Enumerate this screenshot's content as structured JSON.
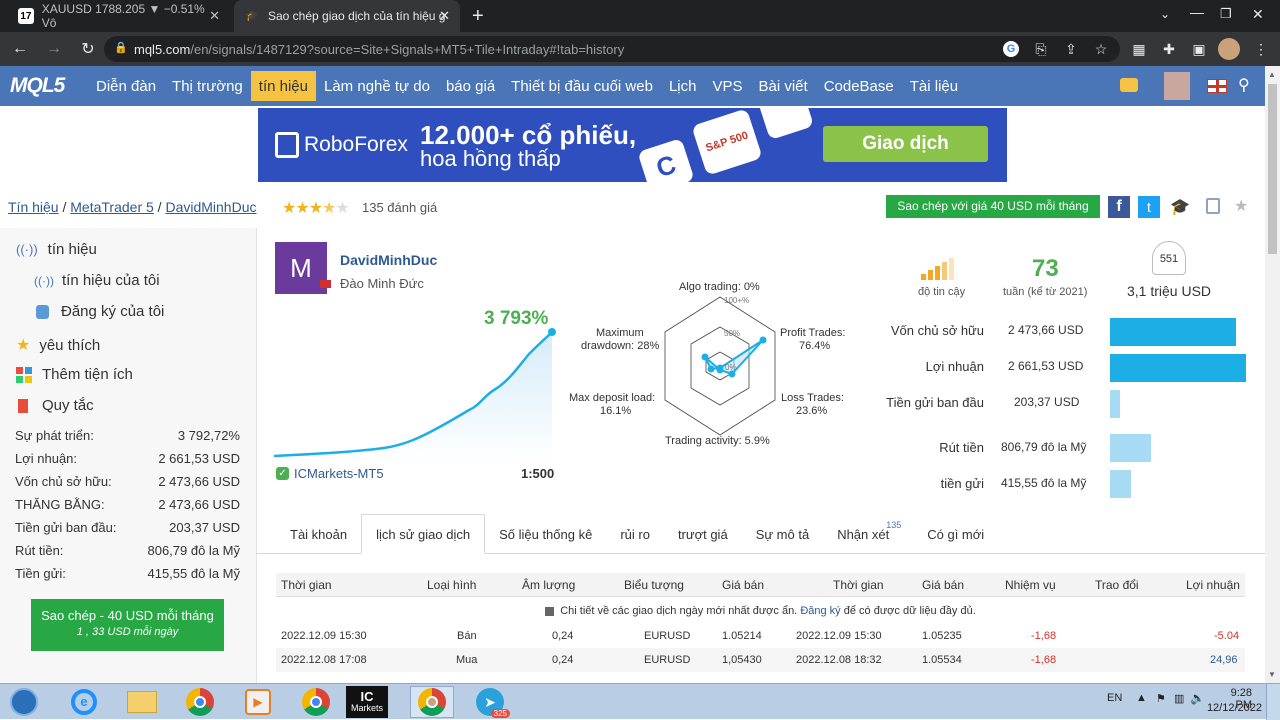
{
  "browser": {
    "tabs": [
      {
        "title": "XAUUSD 1788.205 ▼ −0.51% Vô",
        "icon": "tradingview-icon"
      },
      {
        "title": "Sao chép giao dịch của tín hiệu g",
        "icon": "mql5-icon"
      }
    ],
    "new_tab": "+",
    "url_host": "mql5.com",
    "url_path": "/en/signals/1487129?source=Site+Signals+MT5+Tile+Intraday#!tab=history"
  },
  "nav": {
    "logo": "MQL5",
    "items": [
      "Diễn đàn",
      "Thị trường",
      "tín hiệu",
      "Làm nghề tự do",
      "báo giá",
      "Thiết bị đầu cuối web",
      "Lịch",
      "VPS",
      "Bài viết",
      "CodeBase",
      "Tài liệu"
    ],
    "active": 2
  },
  "banner": {
    "brand": "RoboForex",
    "headline": "12.000+ cổ phiếu,",
    "subline": "hoa hồng thấp",
    "cta": "Giao dịch",
    "chip": "S&P 500"
  },
  "crumbs": {
    "items": [
      "Tín hiệu",
      "MetaTrader 5",
      "DavidMinhDuc"
    ],
    "sep": "/",
    "rating_count": "135 đánh giá",
    "copy_button": "Sao chép với giá 40 USD mỗi tháng"
  },
  "sidebar": {
    "links": [
      "tín hiệu",
      "tín hiệu của tôi",
      "Đăng ký của tôi",
      "yêu thích",
      "Thêm tiện ích",
      "Quy tắc"
    ],
    "stats": [
      {
        "label": "Sự phát triển:",
        "value": "3 792,72%"
      },
      {
        "label": "Lợi nhuận:",
        "value": "2 661,53 USD"
      },
      {
        "label": "Vốn chủ sở hữu:",
        "value": "2 473,66 USD"
      },
      {
        "label": "THĂNG BẰNG:",
        "value": "2 473,66 USD"
      },
      {
        "label": "Tiền gửi ban đầu:",
        "value": "203,37 USD"
      },
      {
        "label": "Rút tiền:",
        "value": "806,79 đô la Mỹ"
      },
      {
        "label": "Tiền gửi:",
        "value": "415,55 đô la Mỹ"
      }
    ],
    "copy_button": "Sao chép - 40 USD mỗi tháng",
    "copy_sub": "1 , 33 USD mỗi ngày"
  },
  "signal": {
    "avatar_letter": "M",
    "name": "DavidMinhDuc",
    "real_name": "Đào Minh Đức",
    "growth": "3 793%",
    "broker": "ICMarkets-MT5",
    "leverage": "1:500"
  },
  "radar": {
    "labels": {
      "algo": "Algo trading: 0%",
      "profit": "Profit Trades:",
      "profit_val": "76.4%",
      "loss": "Loss Trades:",
      "loss_val": "23.6%",
      "activity": "Trading activity: 5.9%",
      "deposit": "Max deposit load:",
      "deposit_val": "16.1%",
      "drawdown": "Maximum",
      "drawdown2": "drawdown: 28%"
    },
    "ticks": [
      "100+%",
      "50%",
      "0%"
    ]
  },
  "metrics": {
    "reliability_label": "độ tin cậy",
    "weeks": "73",
    "weeks_label": "tuần (kể từ 2021)",
    "subscribers": "551",
    "funds": "3,1 triệu USD"
  },
  "bars": [
    {
      "label": "Vốn chủ sở hữu",
      "value": "2 473,66 USD",
      "fraction": 0.93,
      "color": "#1eaee6"
    },
    {
      "label": "Lợi nhuận",
      "value": "2 661,53 USD",
      "fraction": 1.0,
      "color": "#1eaee6"
    },
    {
      "label": "Tiền gửi ban đầu",
      "value": "203,37 USD",
      "fraction": 0.076,
      "color": "#a6dbf3"
    },
    {
      "label": "Rút tiền",
      "value": "806,79 đô la Mỹ",
      "fraction": 0.3,
      "color": "#a6dbf3"
    },
    {
      "label": "tiền gửi",
      "value": "415,55 đô la Mỹ",
      "fraction": 0.156,
      "color": "#a6dbf3"
    }
  ],
  "tabs": {
    "items": [
      "Tài khoản",
      "lịch sử giao dịch",
      "Số liệu thống kê",
      "rủi ro",
      "trượt giá",
      "Sự mô tả",
      "Nhận xét",
      "Có gì mới"
    ],
    "active": 1,
    "review_badge": "135"
  },
  "history": {
    "headers": [
      "Thời gian",
      "Loại hình",
      "Âm lượng",
      "Biểu tượng",
      "Giá bán",
      "Thời gian",
      "Giá bán",
      "Nhiệm vụ",
      "Trao đổi",
      "Lợi nhuận"
    ],
    "notice_pre": "Chi tiết về các giao dịch ngày mới nhất được ẩn.",
    "notice_link": "Đăng ký",
    "notice_post": "để có được dữ liệu đầy đủ.",
    "rows": [
      [
        "2022.12.09 15:30",
        "Bán",
        "0,24",
        "EURUSD",
        "1.05214",
        "2022.12.09 15:30",
        "1.05235",
        "-1,68",
        "",
        "-5.04"
      ],
      [
        "2022.12.08 17:08",
        "Mua",
        "0,24",
        "EURUSD",
        "1,05430",
        "2022.12.08 18:32",
        "1.05534",
        "-1,68",
        "",
        "24,96"
      ]
    ]
  },
  "taskbar": {
    "lang": "EN",
    "time": "9:28 PM",
    "date": "12/12/2022",
    "badge": "325"
  }
}
